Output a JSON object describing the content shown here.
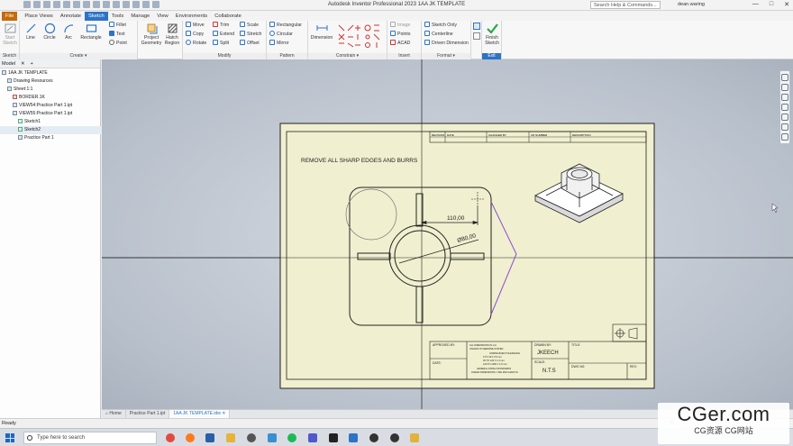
{
  "titlebar": {
    "app_title": "Autodesk Inventor Professional 2023    1AA JK TEMPLATE",
    "help_search": "Search Help & Commands...",
    "user": "dean.waring"
  },
  "ribbon_tabs": [
    "File",
    "Place Views",
    "Annotate",
    "Sketch",
    "Tools",
    "Manage",
    "View",
    "Environments",
    "Collaborate"
  ],
  "ribbon": {
    "start_sketch": "Start Sketch",
    "line": "Line",
    "circle": "Circle",
    "arc": "Arc",
    "rectangle": "Rectangle",
    "fillet": "Fillet",
    "text": "Text",
    "point": "Point",
    "project_geometry": "Project Geometry",
    "hatch_region": "Hatch Region",
    "move": "Move",
    "copy": "Copy",
    "rotate": "Rotate",
    "trim": "Trim",
    "extend": "Extend",
    "split": "Split",
    "scale": "Scale",
    "stretch": "Stretch",
    "offset": "Offset",
    "rectangular": "Rectangular",
    "circular": "Circular",
    "mirror": "Mirror",
    "dimension": "Dimension",
    "image": "Image",
    "points": "Points",
    "acad": "ACAD",
    "sketch_only": "Sketch Only",
    "centerline": "Centerline",
    "driven_dimension": "Driven Dimension",
    "finish_sketch": "Finish Sketch",
    "panels": {
      "sketch": "Sketch",
      "create": "Create ▾",
      "modify": "Modify",
      "pattern": "Pattern",
      "constrain": "Constrain ▾",
      "insert": "Insert",
      "format": "Format ▾",
      "exit": "Exit"
    }
  },
  "browser": {
    "tab": "Model",
    "items": [
      {
        "label": "1AA JK TEMPLATE",
        "level": 0,
        "icon": "drawing"
      },
      {
        "label": "Drawing Resources",
        "level": 1,
        "icon": "folder"
      },
      {
        "label": "Sheet:1:1",
        "level": 1,
        "icon": "sheet"
      },
      {
        "label": "BORDER.1K",
        "level": 2,
        "icon": "border"
      },
      {
        "label": "VIEW54:Practice Part 1.ipt",
        "level": 2,
        "icon": "view"
      },
      {
        "label": "VIEW55:Practice Part 1.ipt",
        "level": 2,
        "icon": "view"
      },
      {
        "label": "Sketch1",
        "level": 3,
        "icon": "sketch"
      },
      {
        "label": "Sketch2",
        "level": 3,
        "icon": "sketch",
        "selected": true
      },
      {
        "label": "Practice Part 1",
        "level": 3,
        "icon": "part"
      }
    ]
  },
  "drawing": {
    "note": "REMOVE ALL SHARP EDGES AND BURRS",
    "dim_linear": "110,00",
    "dim_diameter": "Ø80,00",
    "revision_headers": [
      "REVISION",
      "DATE",
      "CHANGED BY",
      "CR NUMBER",
      "DESCRIPTION"
    ],
    "tb_approved": "APPROVED BY:",
    "tb_date": "DATE:",
    "tb_notes": [
      "ALL DIMENSIONS IN mm",
      "UNLESS OTHERWISE STATED",
      "UNSPECIFIED TOLERANCE",
      "0 TO 30      ±    0.5 mm",
      "30 TO 120    ±    1.0 mm",
      "120 TO 1000  ±    2.0 mm",
      "GENERAL FINISH STANDARDS",
      "LINEAR DIMENSIONS / USE MAN LENGTH"
    ],
    "tb_drawn_label": "DRAWN BY:",
    "tb_drawn_value": "JKEECH",
    "tb_scale_label": "SCALE:",
    "tb_scale_value": "N.T.S",
    "tb_title": "TITLE:",
    "tb_dwg_no": "DWG NO:",
    "tb_rev": "REV:"
  },
  "doc_tabs": [
    "Home",
    "Practice Part 1.ipt",
    "1AA JK TEMPLATE.idw"
  ],
  "status": {
    "left": "Ready",
    "right": "39"
  },
  "taskbar": {
    "search": "Type here to search"
  },
  "watermark": {
    "logo": "CGer.com",
    "sub": "CG资源  CG网站"
  },
  "colors": {
    "accent": "#2e73c5",
    "file_tab": "#c46b0b",
    "sheet": "#f0efcf",
    "sketch_magenta": "#8c4fd1"
  }
}
